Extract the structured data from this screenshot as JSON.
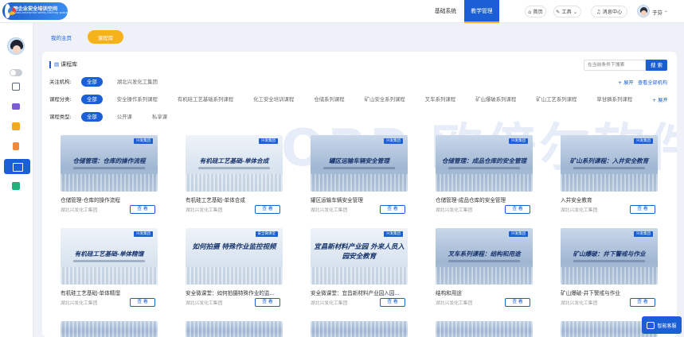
{
  "app": {
    "logo_title": "跨企业安全培训空间",
    "logo_subtitle": "Cross-enterprise safety training space"
  },
  "topnav": [
    {
      "label": "基础系统",
      "active": false
    },
    {
      "label": "教学管理",
      "active": true
    }
  ],
  "header": {
    "home_label": "首页",
    "tools_label": "工具",
    "messages_label": "消息中心",
    "user_name": "于芬"
  },
  "tabs": {
    "home": "我的主页",
    "course": "课程库"
  },
  "library": {
    "title": "课程库",
    "search_placeholder": "在当前条件下搜索",
    "search_button": "搜 索"
  },
  "filters": {
    "org": {
      "label": "关注机构:",
      "options": [
        "全部",
        "湖北兴发化工集团"
      ],
      "selected": "全部",
      "expand_label": "+ 展开",
      "view_all_label": "查看全部机构"
    },
    "category": {
      "label": "课程分类:",
      "options": [
        "全部",
        "安全操作系列课程",
        "有机硅工艺基础系列课程",
        "化工安全培训课程",
        "仓储系列课程",
        "矿山安全系列课程",
        "叉车系列课程",
        "矿山爆破系列课程",
        "矿山工艺系列课程",
        "草甘膦系列课程"
      ],
      "selected": "全部",
      "expand_label": "+ 展开"
    },
    "type": {
      "label": "课程类型:",
      "options": [
        "全部",
        "公开课",
        "私享课"
      ],
      "selected": "全部"
    }
  },
  "cards": [
    {
      "title": "仓储管理-仓库的操作流程",
      "org": "湖北兴发化工集团",
      "button": "查 看",
      "thumb_text": "仓储管理：仓库的操作流程",
      "thumb_logo": "兴发集团",
      "style": "mid"
    },
    {
      "title": "有机硅工艺基础-单体合成",
      "org": "湖北兴发化工集团",
      "button": "查 看",
      "thumb_text": "有机硅工艺基础-单体合成",
      "thumb_logo": "兴发集团",
      "style": "light"
    },
    {
      "title": "罐区运输车辆安全管理",
      "org": "湖北兴发化工集团",
      "button": "查 看",
      "thumb_text": "罐区运输车辆安全管理",
      "thumb_logo": "兴发集团",
      "style": "mid"
    },
    {
      "title": "仓储管理-成品仓库的安全管理",
      "org": "湖北兴发化工集团",
      "button": "查 看",
      "thumb_text": "仓储管理：成品仓库的安全管理",
      "thumb_logo": "兴发集团",
      "style": "mid"
    },
    {
      "title": "入井安全教育",
      "org": "湖北兴发化工集团",
      "button": "查 看",
      "thumb_text": "矿山系列课程：入井安全教育",
      "thumb_logo": "兴发集团",
      "style": "mid"
    },
    {
      "title": "有机硅工艺基础-单体精馏",
      "org": "湖北兴发化工集团",
      "button": "查 看",
      "thumb_text": "有机硅工艺基础-单体精馏",
      "thumb_logo": "兴发集团",
      "style": "light"
    },
    {
      "title": "安全微课堂：如何拍摄特殊作业的监...",
      "org": "湖北兴发化工集团",
      "button": "查 看",
      "thumb_text": "如何拍摄 特殊作业监控视频",
      "thumb_logo": "安全微课堂",
      "style": "light"
    },
    {
      "title": "安全微课堂：宜昌新材料产业园入园...",
      "org": "湖北兴发化工集团",
      "button": "查 看",
      "thumb_text": "宜昌新材料产业园 外来人员入园安全教育",
      "thumb_logo": "兴发集团",
      "style": "light"
    },
    {
      "title": "结构和用途",
      "org": "湖北兴发化工集团",
      "button": "查 看",
      "thumb_text": "叉车系列课程：结构和用途",
      "thumb_logo": "兴发集团",
      "style": "mid"
    },
    {
      "title": "矿山爆破-井下警戒与作业",
      "org": "湖北兴发化工集团",
      "button": "查 看",
      "thumb_text": "矿山爆破：井下警戒与作业",
      "thumb_logo": "兴发集团",
      "style": "mid"
    }
  ],
  "watermark": "OBP 欧倍尔软件",
  "helper_label": "智能客服"
}
